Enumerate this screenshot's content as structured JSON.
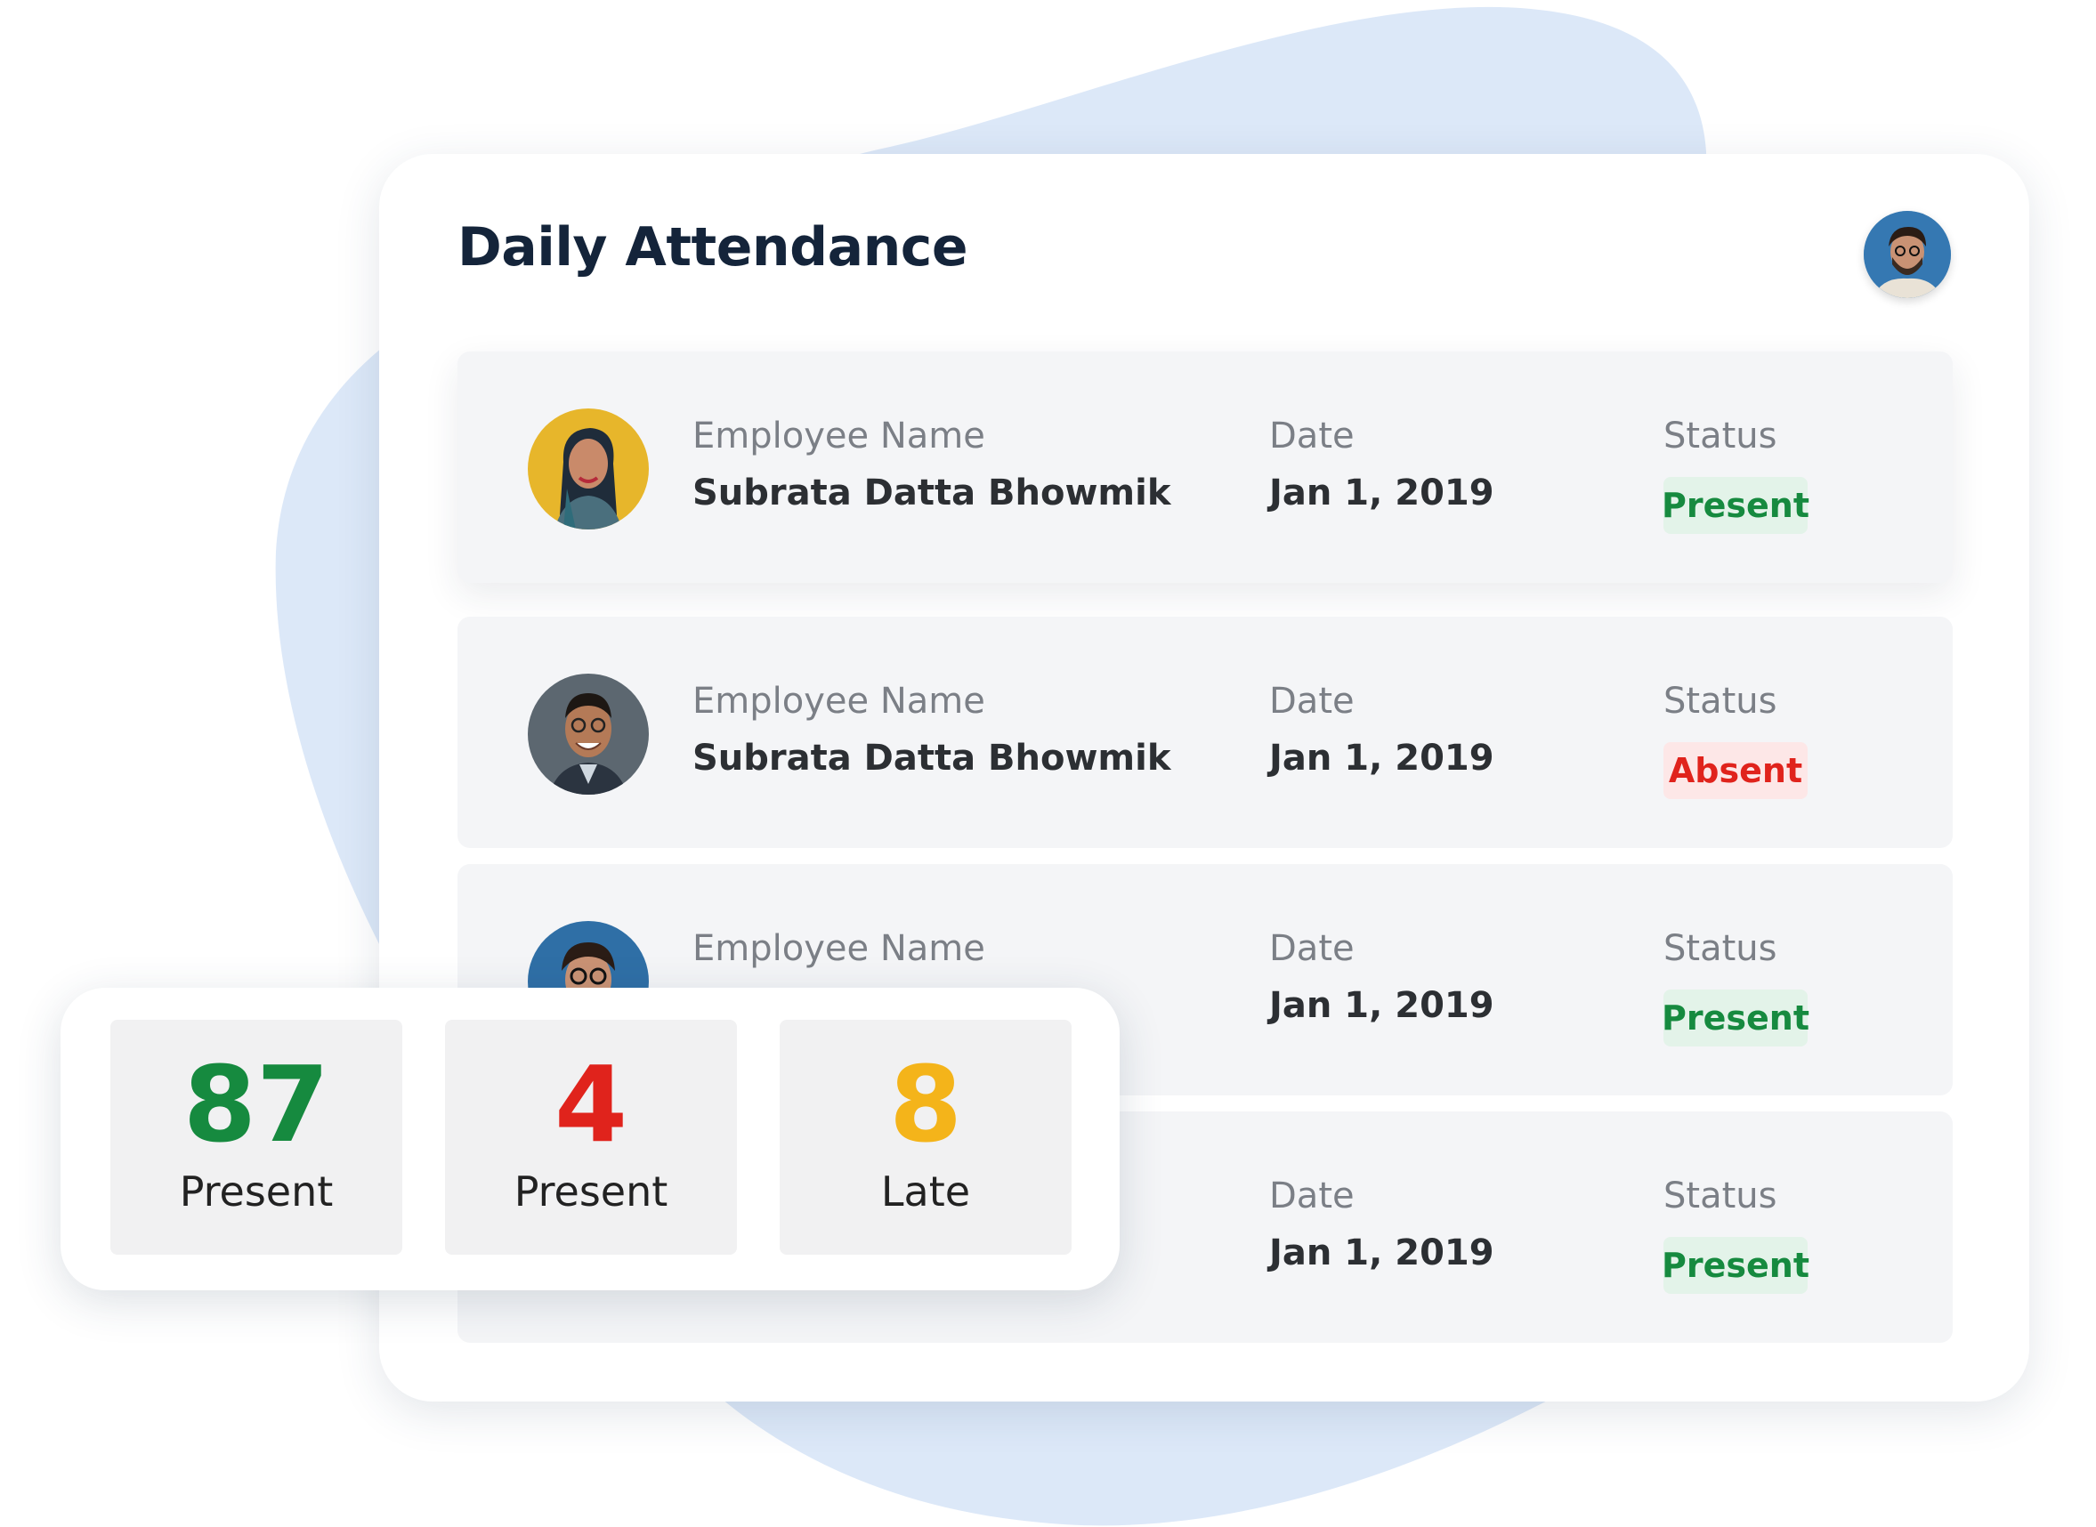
{
  "colors": {
    "present": "#168a3f",
    "absent": "#e0231c",
    "late": "#f4b41a",
    "blob": "#dce8f8"
  },
  "header": {
    "title": "Daily Attendance",
    "user_avatar": "user-avatar"
  },
  "rows": [
    {
      "avatar": "woman-avatar",
      "name_label": "Employee Name",
      "name": "Subrata Datta Bhowmik",
      "date_label": "Date",
      "date": "Jan 1, 2019",
      "status_label": "Status",
      "status": "Present"
    },
    {
      "avatar": "man-avatar",
      "name_label": "Employee Name",
      "name": "Subrata Datta Bhowmik",
      "date_label": "Date",
      "date": "Jan 1, 2019",
      "status_label": "Status",
      "status": "Absent"
    },
    {
      "avatar": "man-glasses-avatar",
      "name_label": "Employee Name",
      "date_label": "Date",
      "date": "Jan 1, 2019",
      "status_label": "Status",
      "status": "Present"
    },
    {
      "date_label": "Date",
      "date": "Jan 1, 2019",
      "status_label": "Status",
      "status": "Present"
    }
  ],
  "summary": [
    {
      "value": "87",
      "label": "Present"
    },
    {
      "value": "4",
      "label": "Present"
    },
    {
      "value": "8",
      "label": "Late"
    }
  ]
}
